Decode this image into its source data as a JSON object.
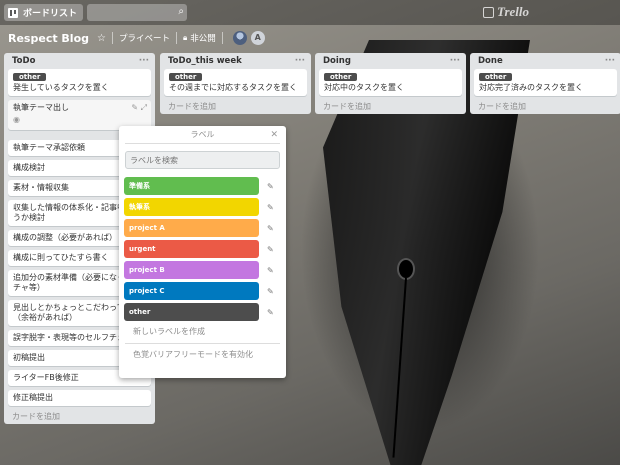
{
  "topbar": {
    "boards_label": "ボードリスト",
    "search_placeholder": "",
    "logo_text": "Trello"
  },
  "board": {
    "title": "Respect Blog",
    "visibility_1": "プライベート",
    "visibility_2": "非公開",
    "member_initial": "A"
  },
  "lists": [
    {
      "title": "ToDo",
      "cards": [
        {
          "label": "other",
          "text": "発生しているタスクを置く"
        },
        {
          "text": "執筆テーマ出し"
        },
        {
          "text": "執筆テーマ承認依頼"
        },
        {
          "text": "構成検討"
        },
        {
          "text": "素材・情報収集"
        },
        {
          "text": "収集した情報の体系化・記事中で使うか検討"
        },
        {
          "text": "構成の調整（必要があれば）"
        },
        {
          "text": "構成に則ってひたすら書く"
        },
        {
          "text": "追加分の素材準備（必要になったプチャ等）"
        },
        {
          "text": "見出しとかちょっとこだわってみる（余裕があれば）"
        },
        {
          "text": "誤字脱字・表現等のセルフチェック"
        },
        {
          "text": "初稿提出"
        },
        {
          "text": "ライターFB後修正"
        },
        {
          "text": "修正稿提出"
        }
      ],
      "add_card": "カードを追加"
    },
    {
      "title": "ToDo_this week",
      "cards": [
        {
          "label": "other",
          "text": "その週までに対応するタスクを置く"
        }
      ],
      "add_card": "カードを追加"
    },
    {
      "title": "Doing",
      "cards": [
        {
          "label": "other",
          "text": "対応中のタスクを置く"
        }
      ],
      "add_card": "カードを追加"
    },
    {
      "title": "Done",
      "cards": [
        {
          "label": "other",
          "text": "対応完了済みのタスクを置く"
        }
      ],
      "add_card": "カードを追加"
    }
  ],
  "label_popover": {
    "title": "ラベル",
    "search_placeholder": "ラベルを検索",
    "labels": [
      {
        "name": "準備系",
        "color": "#61bd4f"
      },
      {
        "name": "執筆系",
        "color": "#f2d600"
      },
      {
        "name": "project A",
        "color": "#ffab4a"
      },
      {
        "name": "urgent",
        "color": "#eb5a46"
      },
      {
        "name": "project B",
        "color": "#c377e0"
      },
      {
        "name": "project C",
        "color": "#0079bf"
      },
      {
        "name": "other",
        "color": "#4d4d4d"
      }
    ],
    "create_link": "新しいラベルを作成",
    "colorblind_link": "色覚バリアフリーモードを有効化"
  }
}
